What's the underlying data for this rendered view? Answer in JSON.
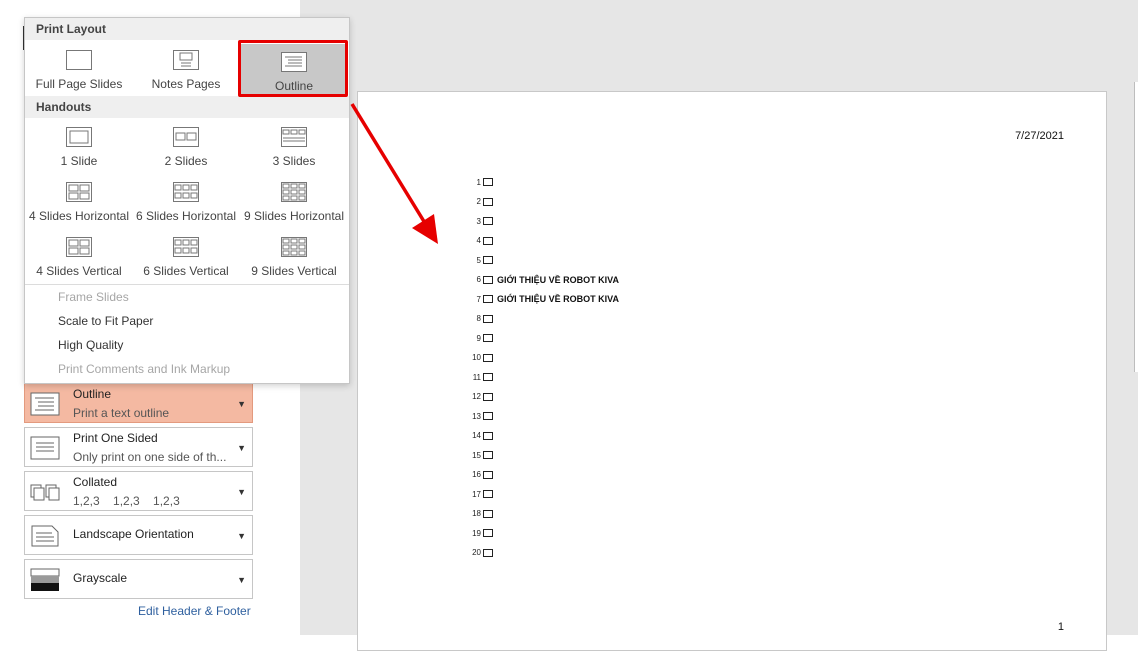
{
  "print_layout": {
    "heading": "Print Layout",
    "tiles": [
      {
        "label": "Full Page Slides",
        "icon": "full-page-slide-icon"
      },
      {
        "label": "Notes Pages",
        "icon": "notes-pages-icon"
      },
      {
        "label": "Outline",
        "icon": "outline-icon",
        "selected": true
      }
    ]
  },
  "handouts": {
    "heading": "Handouts",
    "tiles": [
      {
        "label": "1 Slide"
      },
      {
        "label": "2 Slides"
      },
      {
        "label": "3 Slides"
      },
      {
        "label": "4 Slides Horizontal"
      },
      {
        "label": "6 Slides Horizontal"
      },
      {
        "label": "9 Slides Horizontal"
      },
      {
        "label": "4 Slides Vertical"
      },
      {
        "label": "6 Slides Vertical"
      },
      {
        "label": "9 Slides Vertical"
      }
    ]
  },
  "menu_options": [
    {
      "label": "Frame Slides",
      "enabled": false
    },
    {
      "label": "Scale to Fit Paper",
      "enabled": true
    },
    {
      "label": "High Quality",
      "enabled": true
    },
    {
      "label": "Print Comments and Ink Markup",
      "enabled": false
    }
  ],
  "settings": [
    {
      "title": "Outline",
      "desc": "Print a text outline",
      "icon": "outline-icon",
      "active": true
    },
    {
      "title": "Print One Sided",
      "desc": "Only print on one side of th...",
      "icon": "one-sided-icon"
    },
    {
      "title": "Collated",
      "desc": "1,2,3    1,2,3    1,2,3",
      "icon": "collated-icon"
    },
    {
      "title": "Landscape Orientation",
      "icon": "landscape-icon"
    },
    {
      "title": "Grayscale",
      "icon": "grayscale-icon"
    }
  ],
  "edit_header_footer": "Edit Header & Footer",
  "preview": {
    "date": "7/27/2021",
    "page_number": "1",
    "outline_rows": [
      {
        "num": "1",
        "text": ""
      },
      {
        "num": "2",
        "text": ""
      },
      {
        "num": "3",
        "text": ""
      },
      {
        "num": "4",
        "text": ""
      },
      {
        "num": "5",
        "text": ""
      },
      {
        "num": "6",
        "text": "GIỚI THIỆU VỀ ROBOT KIVA"
      },
      {
        "num": "7",
        "text": "GIỚI THIỆU VỀ ROBOT KIVA"
      },
      {
        "num": "8",
        "text": ""
      },
      {
        "num": "9",
        "text": ""
      },
      {
        "num": "10",
        "text": ""
      },
      {
        "num": "11",
        "text": ""
      },
      {
        "num": "12",
        "text": ""
      },
      {
        "num": "13",
        "text": ""
      },
      {
        "num": "14",
        "text": ""
      },
      {
        "num": "15",
        "text": ""
      },
      {
        "num": "16",
        "text": ""
      },
      {
        "num": "17",
        "text": ""
      },
      {
        "num": "18",
        "text": ""
      },
      {
        "num": "19",
        "text": ""
      },
      {
        "num": "20",
        "text": ""
      }
    ]
  },
  "colors": {
    "highlight": "#e60000",
    "active_setting": "#f4b9a2",
    "link": "#2e5f9e"
  }
}
